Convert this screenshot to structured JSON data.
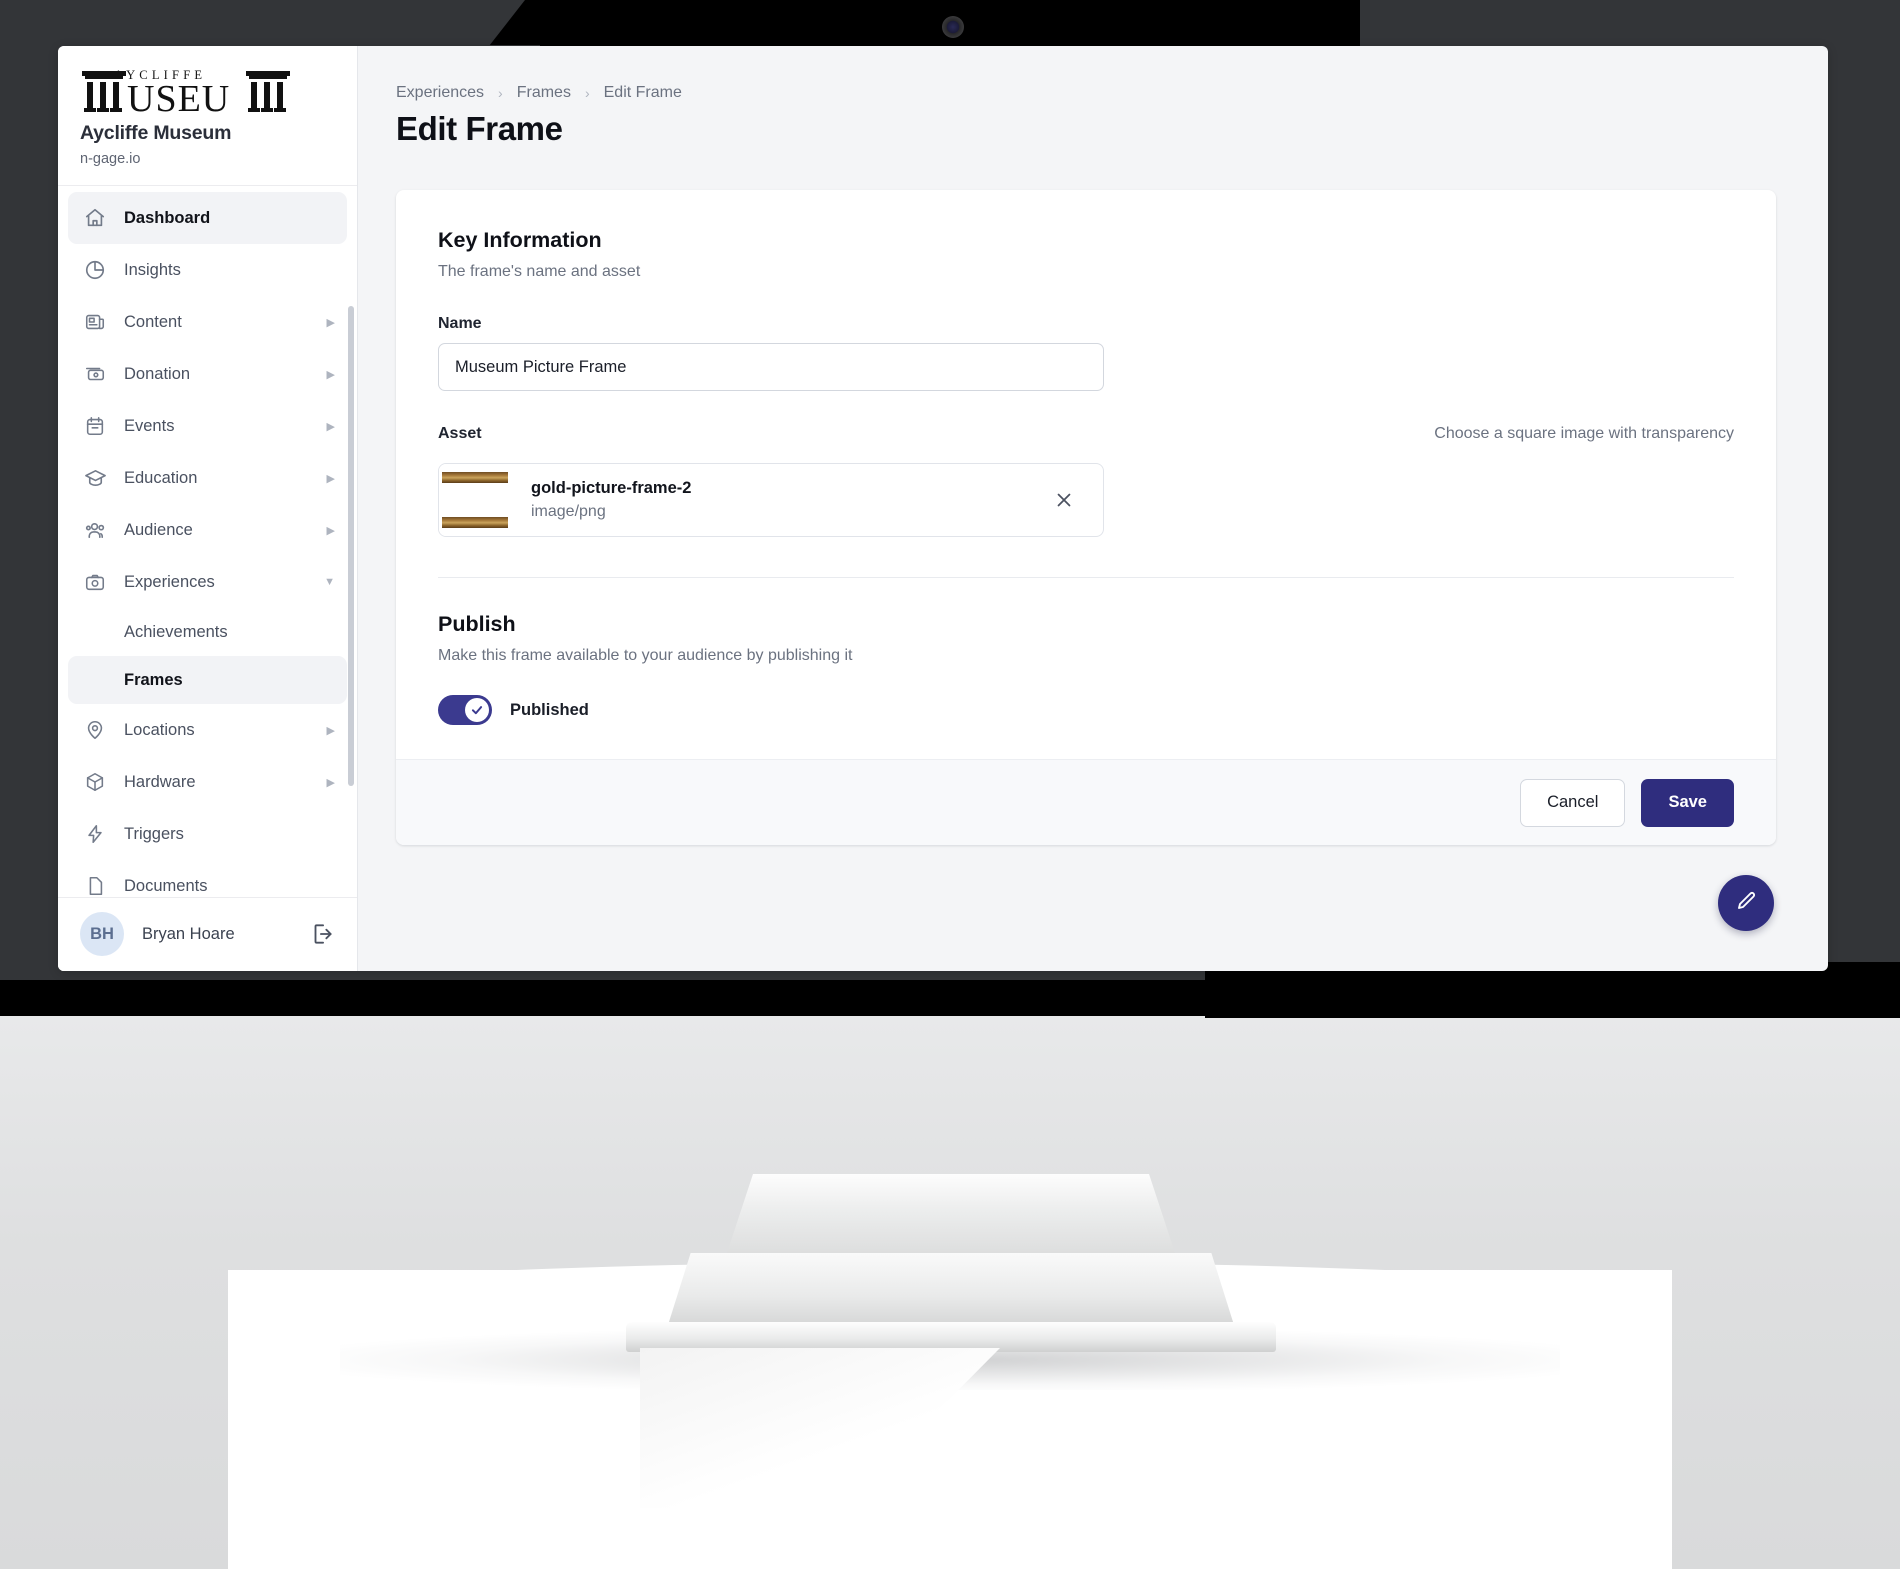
{
  "brand": {
    "logo_top_text": "A Y C L I F F E",
    "logo_main_text": "MUSEUM",
    "name": "Aycliffe Museum",
    "domain": "n-gage.io"
  },
  "sidebar": {
    "items": [
      {
        "label": "Dashboard",
        "icon": "home-icon",
        "active": true,
        "expandable": false,
        "child": false
      },
      {
        "label": "Insights",
        "icon": "pie-chart-icon",
        "active": false,
        "expandable": false,
        "child": false
      },
      {
        "label": "Content",
        "icon": "news-icon",
        "active": false,
        "expandable": true,
        "child": false
      },
      {
        "label": "Donation",
        "icon": "money-icon",
        "active": false,
        "expandable": true,
        "child": false
      },
      {
        "label": "Events",
        "icon": "calendar-icon",
        "active": false,
        "expandable": true,
        "child": false
      },
      {
        "label": "Education",
        "icon": "graduation-icon",
        "active": false,
        "expandable": true,
        "child": false
      },
      {
        "label": "Audience",
        "icon": "people-icon",
        "active": false,
        "expandable": true,
        "child": false
      },
      {
        "label": "Experiences",
        "icon": "camera-icon",
        "active": false,
        "expandable": true,
        "expanded": true,
        "child": false
      },
      {
        "label": "Achievements",
        "icon": "",
        "active": false,
        "expandable": false,
        "child": true
      },
      {
        "label": "Frames",
        "icon": "",
        "active": true,
        "expandable": false,
        "child": true
      },
      {
        "label": "Locations",
        "icon": "pin-icon",
        "active": false,
        "expandable": true,
        "child": false
      },
      {
        "label": "Hardware",
        "icon": "cube-icon",
        "active": false,
        "expandable": true,
        "child": false
      },
      {
        "label": "Triggers",
        "icon": "bolt-icon",
        "active": false,
        "expandable": false,
        "child": false
      },
      {
        "label": "Documents",
        "icon": "document-icon",
        "active": false,
        "expandable": false,
        "child": false
      }
    ],
    "caret_collapsed": "▶",
    "caret_expanded": "▼"
  },
  "user": {
    "initials": "BH",
    "name": "Bryan Hoare",
    "logout_icon": "logout-icon"
  },
  "breadcrumb": {
    "items": [
      "Experiences",
      "Frames",
      "Edit Frame"
    ],
    "separator": "›"
  },
  "page": {
    "title": "Edit Frame"
  },
  "key_information": {
    "title": "Key Information",
    "subtitle": "The frame's name and asset",
    "name_label": "Name",
    "name_value": "Museum Picture Frame",
    "name_placeholder": "Name",
    "asset_label": "Asset",
    "asset_hint": "Choose a square image with transparency",
    "asset_file_name": "gold-picture-frame-2",
    "asset_file_type": "image/png",
    "asset_remove_icon": "close-icon",
    "asset_thumbnail_name": "gold-picture-frame-thumbnail"
  },
  "publish": {
    "title": "Publish",
    "subtitle": "Make this frame available to your audience by publishing it",
    "toggle_label": "Published",
    "toggle_on": true,
    "toggle_check_icon": "check-icon"
  },
  "actions": {
    "cancel_label": "Cancel",
    "save_label": "Save",
    "fab_icon": "pencil-icon"
  },
  "colors": {
    "primary": "#2f2d7e",
    "toggle_on": "#3b3a8f",
    "page_bg": "#f4f5f7",
    "card_bg": "#ffffff",
    "text": "#0e1017",
    "muted": "#6b7280"
  }
}
